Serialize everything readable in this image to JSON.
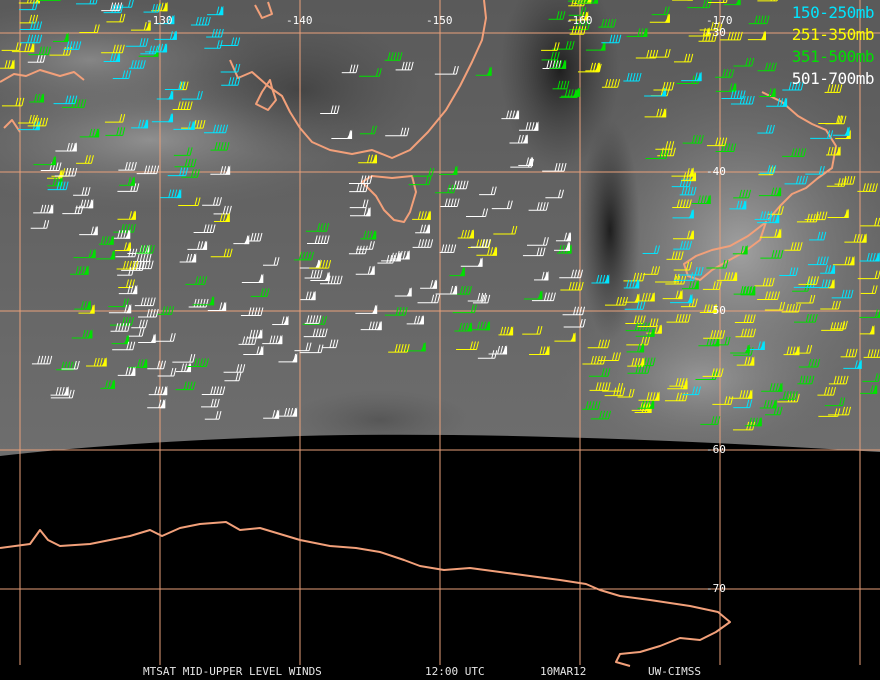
{
  "map": {
    "longitude_labels": [
      "-130",
      "-140",
      "-150",
      "-160",
      "-170"
    ],
    "latitude_labels": [
      "-30",
      "-40",
      "-50",
      "-60",
      "-70"
    ]
  },
  "legend": [
    {
      "label": "150-250mb",
      "color": "#00e5ff"
    },
    {
      "label": "251-350mb",
      "color": "#ffff00"
    },
    {
      "label": "351-500mb",
      "color": "#00e000"
    },
    {
      "label": "501-700mb",
      "color": "#ffffff"
    }
  ],
  "footer": {
    "product": "MTSAT MID-UPPER LEVEL WINDS",
    "time": "12:00 UTC",
    "date": "10MAR12",
    "source": "UW-CIMSS"
  },
  "colors": {
    "coastline": "#f2a07a",
    "grid": "#e8a07a",
    "background": "#000000"
  },
  "icons": [
    "wind-barb-icon"
  ]
}
